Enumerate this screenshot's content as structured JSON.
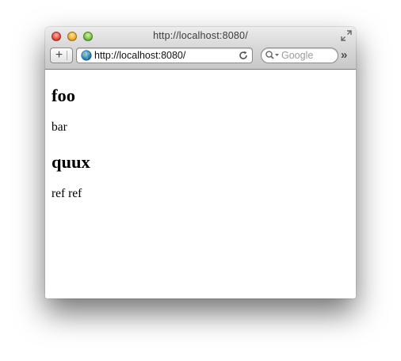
{
  "window": {
    "title": "http://localhost:8080/",
    "controls": {
      "close_color": "#e8493e",
      "minimize_color": "#f0ad2b",
      "maximize_color": "#79c243"
    }
  },
  "toolbar": {
    "add_label": "+",
    "address": "http://localhost:8080/",
    "search_placeholder": "Google",
    "overflow_label": "»"
  },
  "icons": {
    "address": "globe-icon",
    "reload": "reload-icon",
    "search": "magnifier-icon",
    "fullscreen": "fullscreen-icon"
  },
  "page": {
    "heading_1": "foo",
    "paragraph_1": "bar",
    "heading_2": "quux",
    "paragraph_2": "ref ref"
  }
}
